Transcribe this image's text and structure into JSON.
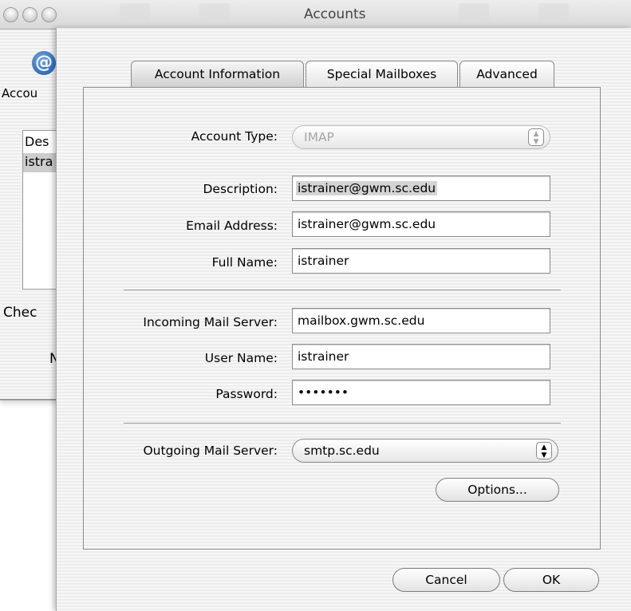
{
  "window": {
    "title": "Accounts"
  },
  "background": {
    "toolbar_label": "Accou",
    "list_header": "Des",
    "list_item": "istra",
    "check_label": "Chec",
    "n_label": "N"
  },
  "tabs": [
    {
      "label": "Account Information",
      "selected": true
    },
    {
      "label": "Special Mailboxes",
      "selected": false
    },
    {
      "label": "Advanced",
      "selected": false
    }
  ],
  "form": {
    "account_type": {
      "label": "Account Type:",
      "value": "IMAP"
    },
    "description": {
      "label": "Description:",
      "value": "istrainer@gwm.sc.edu"
    },
    "email": {
      "label": "Email Address:",
      "value": "istrainer@gwm.sc.edu"
    },
    "full_name": {
      "label": "Full Name:",
      "value": "istrainer"
    },
    "incoming_server": {
      "label": "Incoming Mail Server:",
      "value": "mailbox.gwm.sc.edu"
    },
    "user_name": {
      "label": "User Name:",
      "value": "istrainer"
    },
    "password": {
      "label": "Password:",
      "value": "•••••••"
    },
    "outgoing_server": {
      "label": "Outgoing Mail Server:",
      "value": "smtp.sc.edu"
    }
  },
  "buttons": {
    "options": "Options...",
    "cancel": "Cancel",
    "ok": "OK"
  },
  "icons": {
    "account": "@"
  }
}
